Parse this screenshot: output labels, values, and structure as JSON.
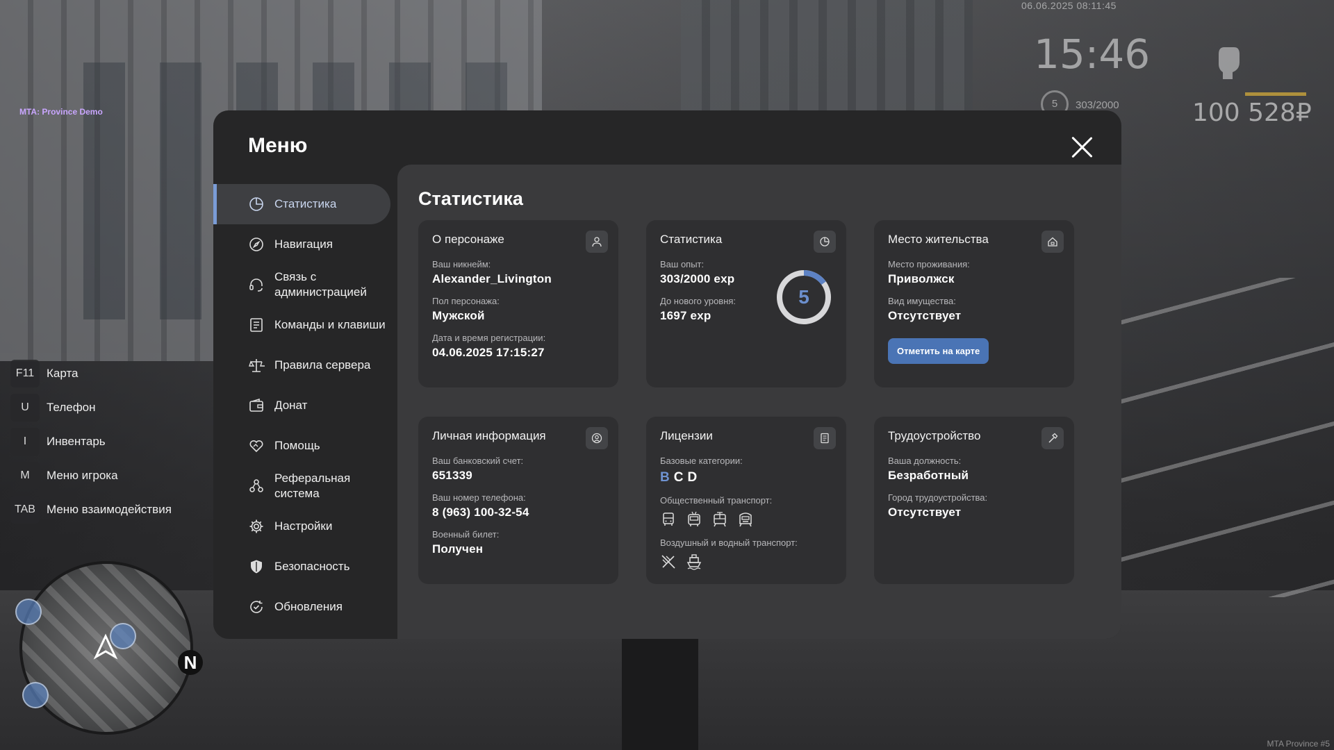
{
  "hud": {
    "server_tag": "MTA: Province Demo",
    "datetime": "06.06.2025 08:11:45",
    "clock": "15:46",
    "level": "5",
    "exp": "303/2000",
    "money": "100 528₽",
    "watermark": "MTA Province #5"
  },
  "hotkeys": [
    {
      "key": "F11",
      "label": "Карта"
    },
    {
      "key": "U",
      "label": "Телефон"
    },
    {
      "key": "I",
      "label": "Инвентарь"
    },
    {
      "key": "M",
      "label": "Меню игрока"
    },
    {
      "key": "TAB",
      "label": "Меню взаимодействия"
    }
  ],
  "minimap": {
    "north": "N"
  },
  "menu": {
    "title": "Меню",
    "nav": [
      {
        "label": "Статистика",
        "icon": "chart-pie-icon",
        "active": true
      },
      {
        "label": "Навигация",
        "icon": "compass-icon"
      },
      {
        "label": "Связь с администрацией",
        "icon": "headset-icon"
      },
      {
        "label": "Команды и клавиши",
        "icon": "document-list-icon"
      },
      {
        "label": "Правила сервера",
        "icon": "scales-icon"
      },
      {
        "label": "Донат",
        "icon": "wallet-icon"
      },
      {
        "label": "Помощь",
        "icon": "handshake-heart-icon"
      },
      {
        "label": "Реферальная система",
        "icon": "users-network-icon"
      },
      {
        "label": "Настройки",
        "icon": "gear-icon"
      },
      {
        "label": "Безопасность",
        "icon": "shield-icon"
      },
      {
        "label": "Обновления",
        "icon": "refresh-check-icon"
      }
    ]
  },
  "content": {
    "title": "Статистика",
    "character": {
      "title": "О персонаже",
      "nick_label": "Ваш никнейм:",
      "nick": "Alexander_Livington",
      "gender_label": "Пол персонажа:",
      "gender": "Мужской",
      "reg_label": "Дата и время регистрации:",
      "reg": "04.06.2025 17:15:27"
    },
    "stats": {
      "title": "Статистика",
      "exp_label": "Ваш опыт:",
      "exp": "303/2000 exp",
      "next_label": "До нового уровня:",
      "next": "1697 exp",
      "level": "5",
      "progress": 0.1515
    },
    "residence": {
      "title": "Место жительства",
      "place_label": "Место проживания:",
      "place": "Приволжск",
      "property_label": "Вид имущества:",
      "property": "Отсутствует",
      "button": "Отметить на карте"
    },
    "personal": {
      "title": "Личная информация",
      "bank_label": "Ваш банковский счет:",
      "bank": "651339",
      "phone_label": "Ваш номер телефона:",
      "phone": "8 (963) 100-32-54",
      "military_label": "Военный билет:",
      "military": "Получен"
    },
    "licenses": {
      "title": "Лицензии",
      "base_label": "Базовые категории:",
      "categories": [
        {
          "letter": "B",
          "active": true
        },
        {
          "letter": "C",
          "active": false
        },
        {
          "letter": "D",
          "active": false
        }
      ],
      "public_label": "Общественный транспорт:",
      "public_icons": [
        "bus-icon",
        "trolleybus-icon",
        "tram-icon",
        "metro-icon"
      ],
      "air_label": "Воздушный и водный транспорт:",
      "air_icons": [
        "plane-icon",
        "ship-icon"
      ]
    },
    "job": {
      "title": "Трудоустройство",
      "position_label": "Ваша должность:",
      "position": "Безработный",
      "city_label": "Город трудоустройства:",
      "city": "Отсутствует"
    }
  },
  "colors": {
    "accent": "#7a9cd6",
    "button": "#4a74b5",
    "panel": "#262627",
    "content": "#3a3a3c",
    "card": "#2f2f31"
  }
}
